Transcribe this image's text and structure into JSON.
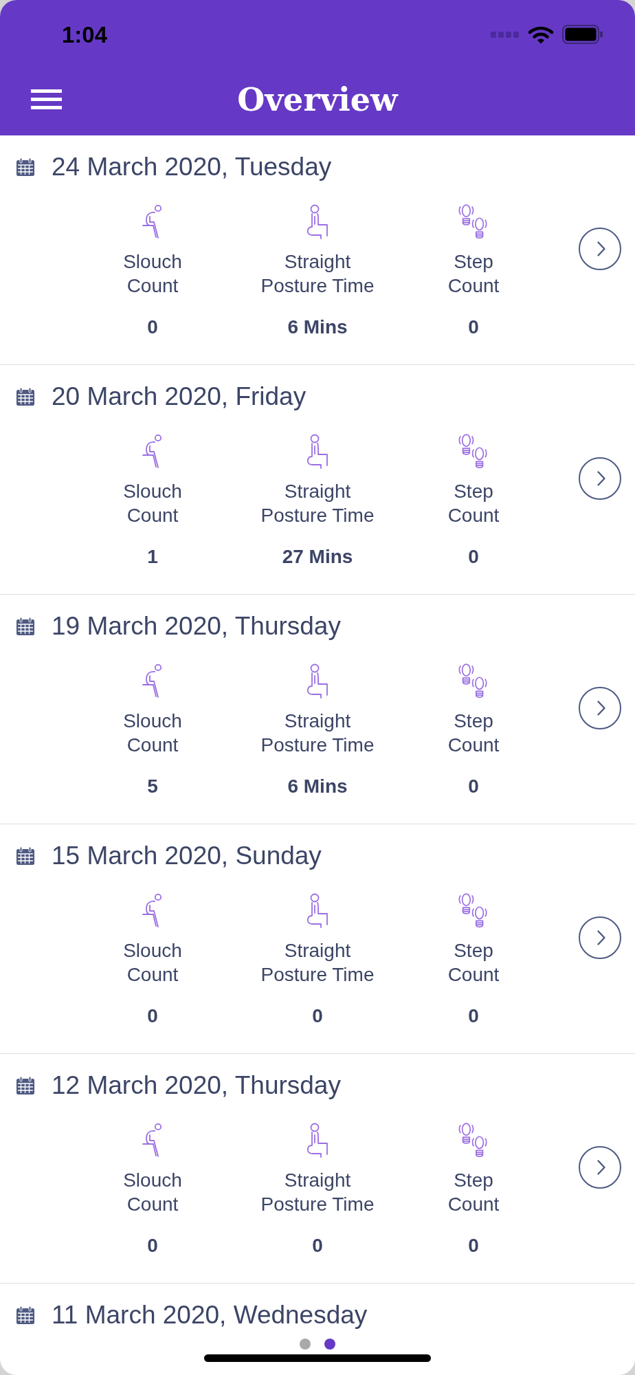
{
  "status_bar": {
    "time": "1:04"
  },
  "nav_bar": {
    "title": "Overview"
  },
  "days": [
    {
      "date": "24 March 2020, Tuesday",
      "metrics": [
        {
          "kind": "slouch",
          "label": "Slouch\nCount",
          "value": "0"
        },
        {
          "kind": "posture",
          "label": "Straight\nPosture Time",
          "value": "6 Mins"
        },
        {
          "kind": "steps",
          "label": "Step\nCount",
          "value": "0"
        }
      ]
    },
    {
      "date": "20 March 2020, Friday",
      "metrics": [
        {
          "kind": "slouch",
          "label": "Slouch\nCount",
          "value": "1"
        },
        {
          "kind": "posture",
          "label": "Straight\nPosture Time",
          "value": "27 Mins"
        },
        {
          "kind": "steps",
          "label": "Step\nCount",
          "value": "0"
        }
      ]
    },
    {
      "date": "19 March 2020, Thursday",
      "metrics": [
        {
          "kind": "slouch",
          "label": "Slouch\nCount",
          "value": "5"
        },
        {
          "kind": "posture",
          "label": "Straight\nPosture Time",
          "value": "6 Mins"
        },
        {
          "kind": "steps",
          "label": "Step\nCount",
          "value": "0"
        }
      ]
    },
    {
      "date": "15 March 2020, Sunday",
      "metrics": [
        {
          "kind": "slouch",
          "label": "Slouch\nCount",
          "value": "0"
        },
        {
          "kind": "posture",
          "label": "Straight\nPosture Time",
          "value": "0"
        },
        {
          "kind": "steps",
          "label": "Step\nCount",
          "value": "0"
        }
      ]
    },
    {
      "date": "12 March 2020, Thursday",
      "metrics": [
        {
          "kind": "slouch",
          "label": "Slouch\nCount",
          "value": "0"
        },
        {
          "kind": "posture",
          "label": "Straight\nPosture Time",
          "value": "0"
        },
        {
          "kind": "steps",
          "label": "Step\nCount",
          "value": "0"
        }
      ]
    },
    {
      "date": "11 March 2020, Wednesday"
    }
  ],
  "page_dots": [
    {
      "selected": false
    },
    {
      "selected": true
    }
  ]
}
